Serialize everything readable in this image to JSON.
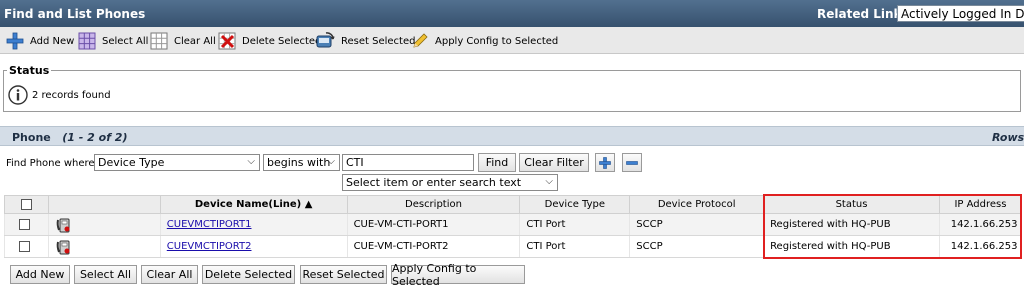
{
  "header": {
    "title": "Find and List Phones",
    "related_label": "Related Links:",
    "related_value": "Actively Logged In Device"
  },
  "toolbar": {
    "add_new": "Add New",
    "select_all": "Select All",
    "clear_all": "Clear All",
    "delete_selected": "Delete Selected",
    "reset_selected": "Reset Selected",
    "apply_config": "Apply Config to Selected"
  },
  "status": {
    "legend": "Status",
    "message": "2 records found"
  },
  "section": {
    "title": "Phone",
    "range": "(1 - 2 of 2)",
    "rows_label": "Rows"
  },
  "find": {
    "label": "Find Phone where",
    "field": "Device Type",
    "operator": "begins with",
    "value": "CTI",
    "find_button": "Find",
    "clear_filter_button": "Clear Filter",
    "secondary_select": "Select item or enter search text"
  },
  "table": {
    "columns": [
      "Device Name(Line)",
      "Description",
      "Device Type",
      "Device Protocol",
      "Status",
      "IP Address"
    ],
    "sort_indicator": "▲",
    "rows": [
      {
        "device_name": "CUEVMCTIPORT1",
        "description": "CUE-VM-CTI-PORT1",
        "device_type": "CTI Port",
        "protocol": "SCCP",
        "status": "Registered with HQ-PUB",
        "ip": "142.1.66.253"
      },
      {
        "device_name": "CUEVMCTIPORT2",
        "description": "CUE-VM-CTI-PORT2",
        "device_type": "CTI Port",
        "protocol": "SCCP",
        "status": "Registered with HQ-PUB",
        "ip": "142.1.66.253"
      }
    ]
  },
  "bottom": {
    "add_new": "Add New",
    "select_all": "Select All",
    "clear_all": "Clear All",
    "delete_selected": "Delete Selected",
    "reset_selected": "Reset Selected",
    "apply_config": "Apply Config to Selected"
  }
}
